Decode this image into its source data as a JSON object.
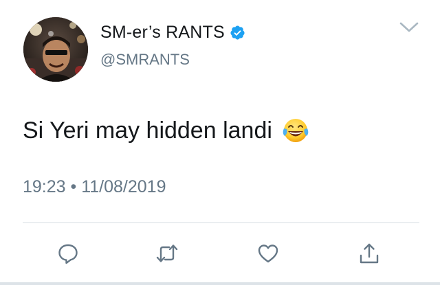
{
  "tweet": {
    "display_name": "SM-er’s RANTS",
    "handle": "@SMRANTS",
    "verified": true,
    "text": "Si Yeri may hidden landi",
    "emoji": "face-with-tears-of-joy-icon",
    "time": "19:23",
    "separator": "•",
    "date": "11/08/2019",
    "timestamp": "19:23 • 11/08/2019"
  },
  "actions": [
    {
      "name": "reply",
      "icon": "reply-icon"
    },
    {
      "name": "retweet",
      "icon": "retweet-icon"
    },
    {
      "name": "like",
      "icon": "heart-icon"
    },
    {
      "name": "share",
      "icon": "share-icon"
    }
  ],
  "colors": {
    "text": "#14171a",
    "secondary": "#657786",
    "verified_blue": "#1da1f2",
    "divider": "#d6dde2",
    "icon": "#657786"
  }
}
